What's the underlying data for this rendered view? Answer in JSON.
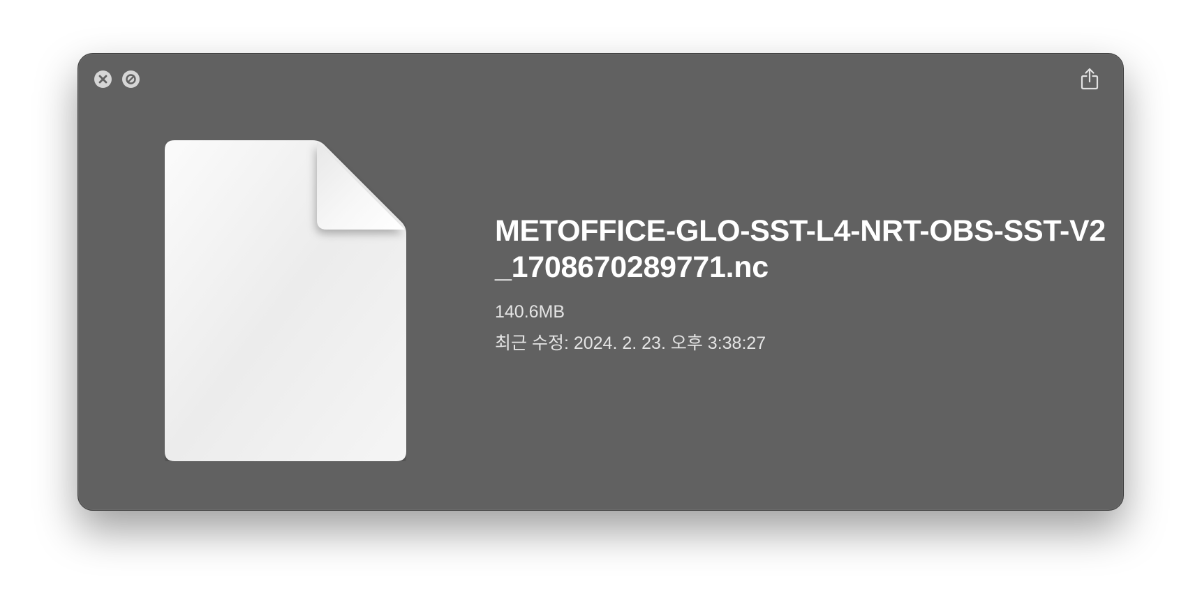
{
  "window": {
    "background": "#616161"
  },
  "toolbar": {
    "close_icon": "close-circle-icon",
    "disable_icon": "no-entry-circle-icon",
    "share_icon": "share-icon"
  },
  "file": {
    "icon": "document-icon",
    "name": "METOFFICE-GLO-SST-L4-NRT-OBS-SST-V2_1708670289771.nc",
    "size": "140.6MB",
    "modified": "최근 수정: 2024. 2. 23. 오후 3:38:27"
  }
}
